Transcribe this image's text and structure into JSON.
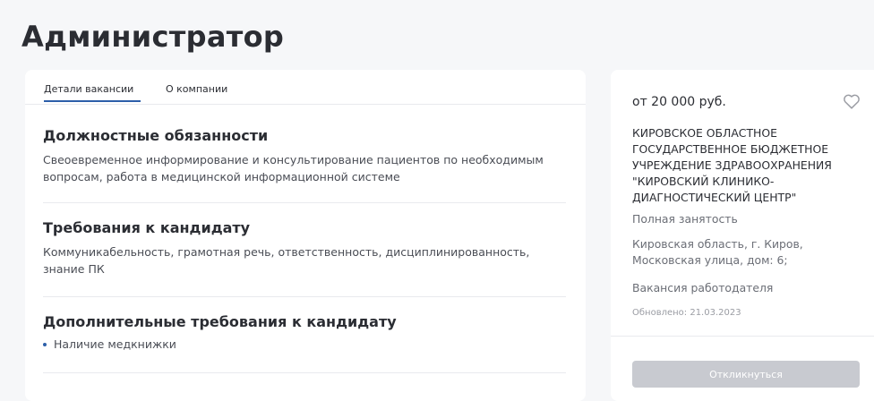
{
  "page": {
    "title": "Администратор"
  },
  "tabs": [
    {
      "label": "Детали вакансии",
      "active": true
    },
    {
      "label": "О компании",
      "active": false
    }
  ],
  "sections": {
    "duties": {
      "title": "Должностные обязанности",
      "text": "Свеоевременное информирование и консультирование пациентов по необходимым вопросам, работа в медицинской информационной системе"
    },
    "requirements": {
      "title": "Требования к кандидату",
      "text": "Коммуникабельность, грамотная речь, ответственность, дисциплинированность, знание ПК"
    },
    "additional": {
      "title": "Дополнительные требования к кандидату",
      "items": [
        "Наличие медкнижки"
      ]
    }
  },
  "sidebar": {
    "salary": "от 20 000 руб.",
    "employer": "КИРОВСКОЕ ОБЛАСТНОЕ ГОСУДАРСТВЕННОЕ БЮДЖЕТНОЕ УЧРЕЖДЕНИЕ ЗДРАВООХРАНЕНИЯ \"КИРОВСКИЙ КЛИНИКО-ДИАГНОСТИЧЕСКИЙ ЦЕНТР\"",
    "employment": "Полная занятость",
    "address": "Кировская область, г. Киров, Московская улица, дом: 6;",
    "vacancy_type": "Вакансия работодателя",
    "updated": "Обновлено: 21.03.2023",
    "respond_label": "Откликнуться",
    "favorite_icon": "heart-icon"
  },
  "colors": {
    "accent": "#2d5fa9",
    "text": "#2b2d33",
    "muted": "#6b6e76",
    "button_disabled": "#c8cad0"
  }
}
